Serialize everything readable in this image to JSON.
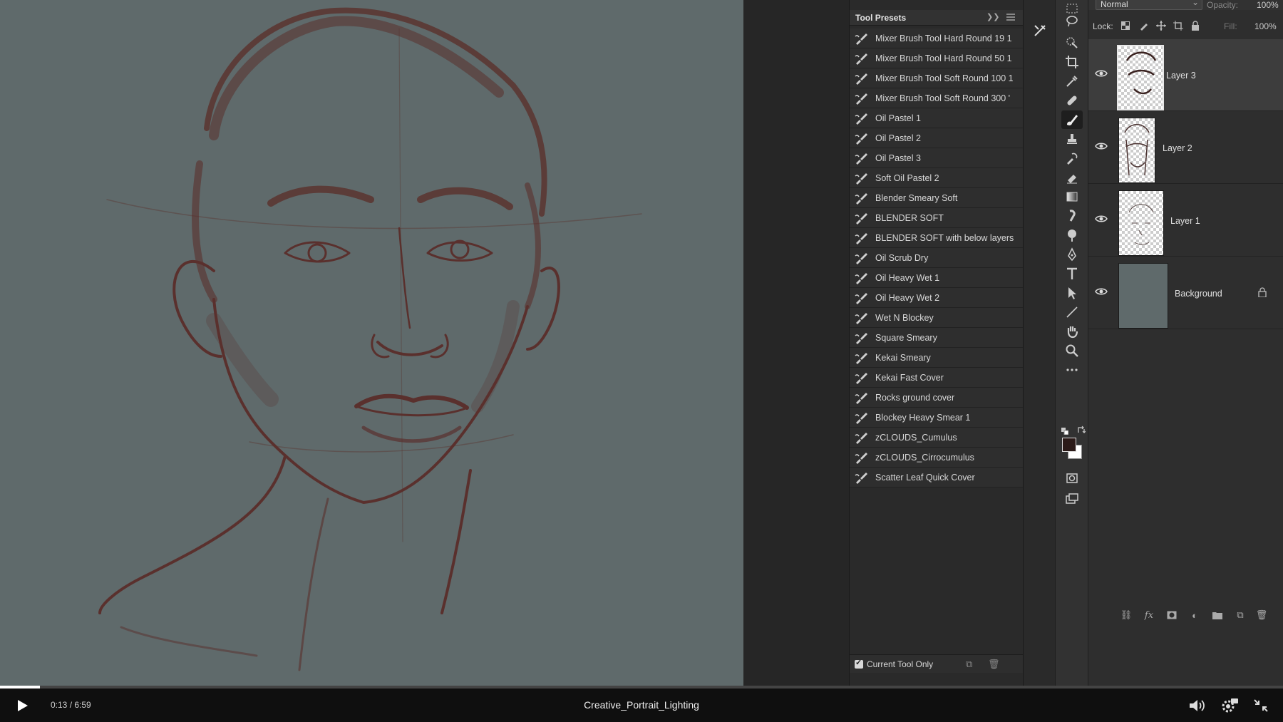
{
  "app": {
    "canvas_bg": "#5f6a6b",
    "sketch_color": "#5a2a26"
  },
  "tool_presets": {
    "title": "Tool Presets",
    "items": [
      "Mixer Brush Tool Hard Round 19 1",
      "Mixer Brush Tool Hard Round 50 1",
      "Mixer Brush Tool Soft Round 100 1",
      "Mixer Brush Tool Soft Round 300 '",
      "Oil Pastel  1",
      "Oil Pastel  2",
      "Oil Pastel  3",
      "Soft Oil Pastel 2",
      "Blender Smeary Soft",
      "BLENDER SOFT",
      "BLENDER   SOFT with below layers",
      "Oil Scrub  Dry",
      "Oil Heavy Wet  1",
      "Oil Heavy Wet  2",
      "Wet N Blockey",
      "Square Smeary",
      "Kekai Smeary",
      "Kekai Fast Cover",
      "Rocks ground cover",
      "Blockey Heavy Smear 1",
      "zCLOUDS_Cumulus",
      "zCLOUDS_Cirrocumulus",
      "Scatter Leaf Quick Cover"
    ],
    "current_tool_only_label": "Current Tool Only"
  },
  "layers_panel": {
    "blend_mode": "Normal",
    "opacity_label": "Opacity:",
    "opacity_value": "100%",
    "lock_label": "Lock:",
    "fill_label": "Fill:",
    "fill_value": "100%",
    "layers": [
      {
        "name": "Layer 3",
        "selected": true,
        "visible": true
      },
      {
        "name": "Layer 2",
        "selected": false,
        "visible": true
      },
      {
        "name": "Layer 1",
        "selected": false,
        "visible": true
      },
      {
        "name": "Background",
        "selected": false,
        "visible": true,
        "locked": true
      }
    ]
  },
  "colors": {
    "foreground": "#2b1a18",
    "background": "#ffffff"
  },
  "player": {
    "current_time": "0:13",
    "duration": "6:59",
    "time_separator": " / ",
    "title": "Creative_Portrait_Lighting",
    "progress_fraction": 0.031
  }
}
